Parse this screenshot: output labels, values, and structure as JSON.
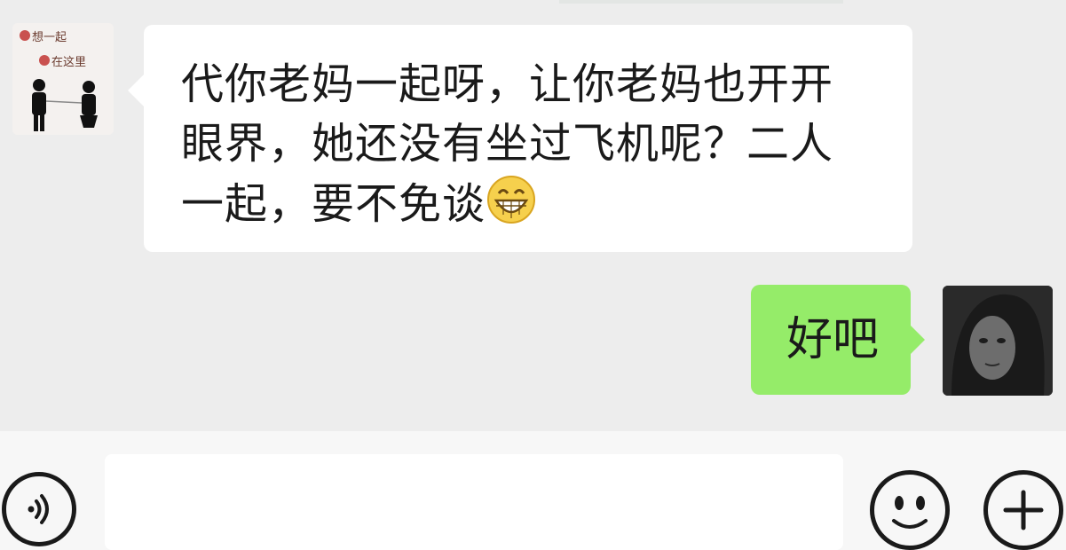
{
  "chat": {
    "messages": [
      {
        "sender": "other",
        "line1": "代你老妈一起呀，让你老妈也开开",
        "line2": "眼界，她还没有坐过飞机呢？二人",
        "line3": "一起，要不免谈",
        "emoji": "grinning-face-emoji"
      },
      {
        "sender": "me",
        "text": "好吧"
      }
    ],
    "avatar_left": {
      "line1": "想一起",
      "line2": "在这里"
    }
  },
  "input_bar": {
    "voice_icon": "voice-wave-icon",
    "emoji_icon": "smiley-face-icon",
    "plus_icon": "plus-icon"
  },
  "colors": {
    "background": "#ededed",
    "incoming_bubble": "#ffffff",
    "outgoing_bubble": "#95ec69",
    "input_bar": "#f7f7f7"
  }
}
